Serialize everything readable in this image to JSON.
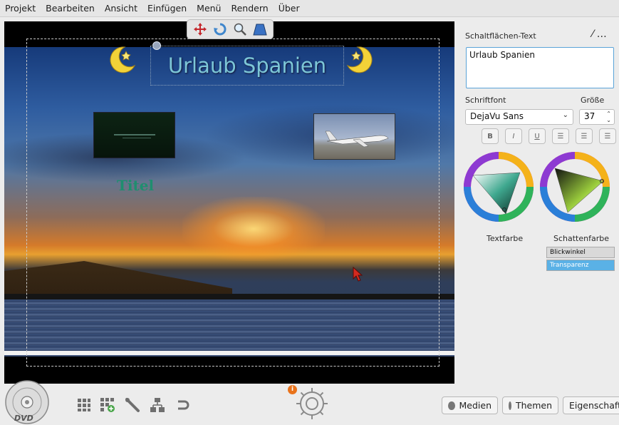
{
  "menu": {
    "items": [
      "Projekt",
      "Bearbeiten",
      "Ansicht",
      "Einfügen",
      "Menü",
      "Rendern",
      "Über"
    ]
  },
  "canvas": {
    "title_text": "Urlaub Spanien",
    "button_text": "Titel"
  },
  "floating_toolbar": {
    "icons": [
      "move-icon",
      "rotate-icon",
      "zoom-icon",
      "perspective-icon"
    ]
  },
  "panel": {
    "button_text_label": "Schaltflächen-Text",
    "button_text_value": "Urlaub Spanien",
    "font_label": "Schriftfont",
    "size_label": "Größe",
    "font_value": "DejaVu Sans",
    "size_value": "37",
    "format_buttons": [
      "B",
      "I",
      "U",
      "left",
      "center",
      "right"
    ],
    "text_color_label": "Textfarbe",
    "shadow_color_label": "Schattenfarbe",
    "slider_angle_label": "Blickwinkel",
    "slider_transparency_label": "Transparenz",
    "colors": {
      "text_color": "#3fa88f",
      "shadow_color": "#9acc3c",
      "accent": "#5ab1e6"
    }
  },
  "bottom": {
    "tabs": [
      "Medien",
      "Themen",
      "Eigenschaften"
    ],
    "info_badge": "i",
    "dvd_label": "DVD"
  }
}
